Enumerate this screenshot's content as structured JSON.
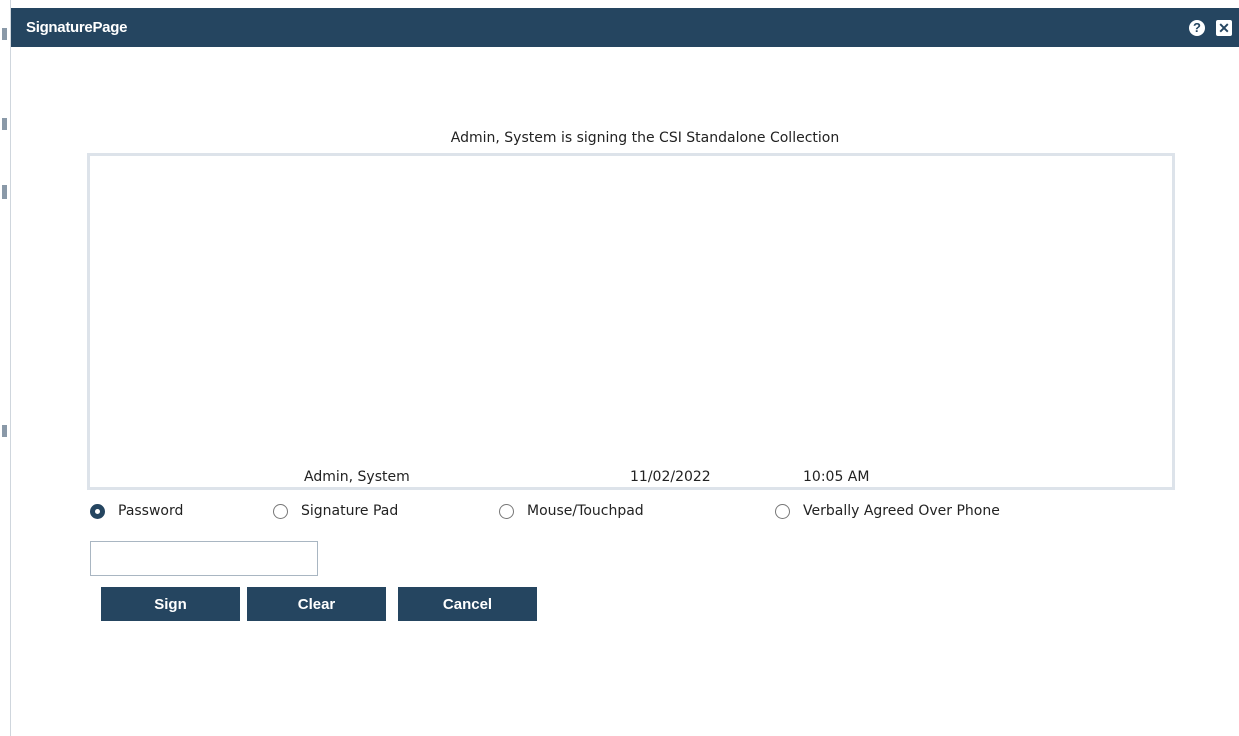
{
  "dialog": {
    "title": "SignaturePage",
    "help_icon": "help-icon",
    "close_icon": "close-icon"
  },
  "signing_caption": "Admin, System is signing the CSI Standalone Collection",
  "signature_box": {
    "signer_name": "Admin, System",
    "date": "11/02/2022",
    "time": "10:05 AM"
  },
  "sign_methods": {
    "selected": "Password",
    "options": [
      {
        "label": "Password",
        "checked": true
      },
      {
        "label": "Signature Pad",
        "checked": false
      },
      {
        "label": "Mouse/Touchpad",
        "checked": false
      },
      {
        "label": "Verbally Agreed Over Phone",
        "checked": false
      }
    ]
  },
  "password_field": {
    "value": "",
    "placeholder": ""
  },
  "buttons": {
    "sign": "Sign",
    "clear": "Clear",
    "cancel": "Cancel"
  },
  "colors": {
    "header_bg": "#254560",
    "button_bg": "#254560",
    "box_border": "#dde3ea"
  }
}
